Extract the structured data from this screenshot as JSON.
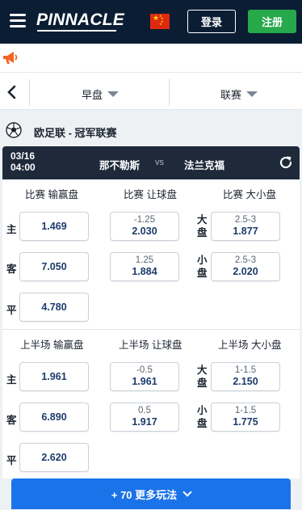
{
  "header": {
    "logo": "PINNACLE",
    "login_label": "登录",
    "register_label": "注册",
    "flag_icon": "china-flag-icon"
  },
  "filters": {
    "market": "早盘",
    "league": "联赛"
  },
  "league": {
    "title": "欧足联 - 冠军联赛"
  },
  "match": {
    "date": "03/16",
    "time": "04:00",
    "home": "那不勒斯",
    "vs": "vs",
    "away": "法兰克福"
  },
  "full_time": {
    "moneyline_header": "比赛 输赢盘",
    "handicap_header": "比赛 让球盘",
    "total_header": "比赛 大小盘",
    "moneyline": [
      {
        "label": "主",
        "price": "1.469"
      },
      {
        "label": "客",
        "price": "7.050"
      },
      {
        "label": "平",
        "price": "4.780"
      }
    ],
    "handicap": [
      {
        "line": "-1.25",
        "price": "2.030"
      },
      {
        "line": "1.25",
        "price": "1.884"
      }
    ],
    "total": [
      {
        "label": "大盘",
        "line": "2.5-3",
        "price": "1.877"
      },
      {
        "label": "小盘",
        "line": "2.5-3",
        "price": "2.020"
      }
    ]
  },
  "first_half": {
    "moneyline_header": "上半场 输赢盘",
    "handicap_header": "上半场 让球盘",
    "total_header": "上半场 大小盘",
    "moneyline": [
      {
        "label": "主",
        "price": "1.961"
      },
      {
        "label": "客",
        "price": "6.890"
      },
      {
        "label": "平",
        "price": "2.620"
      }
    ],
    "handicap": [
      {
        "line": "-0.5",
        "price": "1.961"
      },
      {
        "line": "0.5",
        "price": "1.917"
      }
    ],
    "total": [
      {
        "label": "大盘",
        "line": "1-1.5",
        "price": "2.150"
      },
      {
        "label": "小盘",
        "line": "1-1.5",
        "price": "1.775"
      }
    ]
  },
  "more_button": "+ 70 更多玩法",
  "colors": {
    "header_bg": "#0b1d33",
    "register_green": "#27a84a",
    "match_bar": "#1e2a3a",
    "more_blue": "#1a73e8",
    "megaphone_orange": "#f26522"
  }
}
